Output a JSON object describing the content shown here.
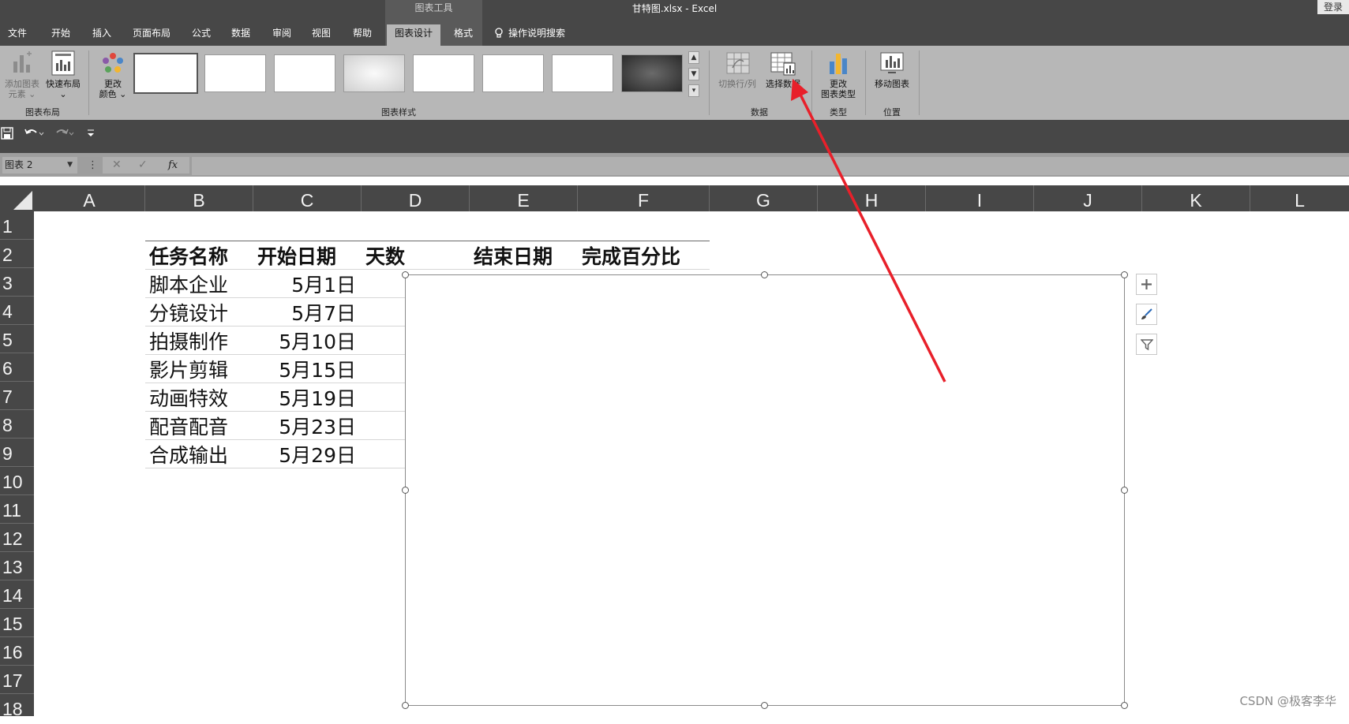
{
  "window": {
    "title": "甘特图.xlsx  -  Excel",
    "context_group": "图表工具",
    "login": "登录"
  },
  "tabs": [
    "文件",
    "开始",
    "插入",
    "页面布局",
    "公式",
    "数据",
    "审阅",
    "视图",
    "帮助",
    "图表设计",
    "格式"
  ],
  "active_tab": "图表设计",
  "search_tab": "操作说明搜索",
  "ribbon": {
    "chart_layout": {
      "add_element_line1": "添加图表",
      "add_element_line2": "元素 ⌄",
      "quick_layout_line1": "快速布局",
      "quick_layout_line2": "⌄",
      "label": "图表布局"
    },
    "chart_styles": {
      "change_color_line1": "更改",
      "change_color_line2": "颜色 ⌄",
      "label": "图表样式"
    },
    "data": {
      "switch_row_col": "切换行/列",
      "select_data": "选择数据",
      "label": "数据"
    },
    "type": {
      "change_type_line1": "更改",
      "change_type_line2": "图表类型",
      "label": "类型"
    },
    "location": {
      "move_chart": "移动图表",
      "label": "位置"
    }
  },
  "formula_bar": {
    "name_box": "图表 2",
    "cancel": "✕",
    "enter": "✓",
    "fx": "fx",
    "value": ""
  },
  "columns": [
    "A",
    "B",
    "C",
    "D",
    "E",
    "F",
    "G",
    "H",
    "I",
    "J",
    "K",
    "L"
  ],
  "rows": [
    "1",
    "2",
    "3",
    "4",
    "5",
    "6",
    "7",
    "8",
    "9",
    "10",
    "11",
    "12",
    "13",
    "14",
    "15",
    "16",
    "17",
    "18"
  ],
  "table": {
    "headers": {
      "task": "任务名称",
      "start": "开始日期",
      "days": "天数",
      "end": "结束日期",
      "percent": "完成百分比"
    },
    "rows": [
      {
        "task": "脚本企业",
        "start": "5月1日"
      },
      {
        "task": "分镜设计",
        "start": "5月7日"
      },
      {
        "task": "拍摄制作",
        "start": "5月10日"
      },
      {
        "task": "影片剪辑",
        "start": "5月15日"
      },
      {
        "task": "动画特效",
        "start": "5月19日"
      },
      {
        "task": "配音配音",
        "start": "5月23日"
      },
      {
        "task": "合成输出",
        "start": "5月29日"
      }
    ]
  },
  "chart_buttons": [
    "chart-elements",
    "chart-styles",
    "chart-filters"
  ],
  "annotation": {
    "color": "#e8202a",
    "target": "select-data-button"
  },
  "watermark": "CSDN @极客李华"
}
